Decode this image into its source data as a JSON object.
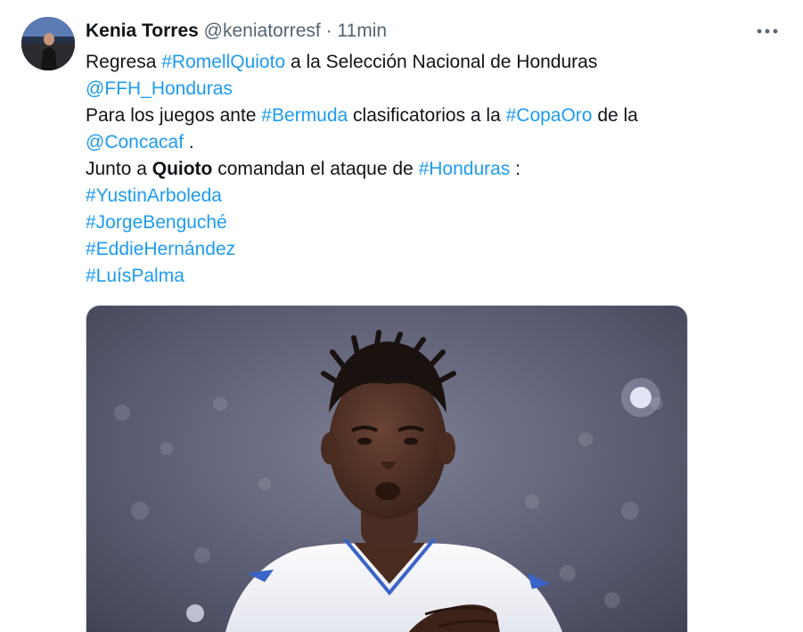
{
  "author": {
    "name": "Kenia Torres",
    "handle": "@keniatorresf",
    "separator": "·",
    "time": "11min"
  },
  "more_icon": "more-horizontal-icon",
  "tweet": {
    "l1_text1": "Regresa ",
    "l1_link1": "#RomellQuioto",
    "l1_text2": " a la Selección Nacional de Honduras",
    "l2_link1": "@FFH_Honduras",
    "l3_text1": "Para los juegos ante ",
    "l3_link1": "#Bermuda",
    "l3_text2": " clasificatorios a la ",
    "l3_link2": "#CopaOro",
    "l3_text3": " de la",
    "l4_link1": "@Concacaf",
    "l4_text1": " .",
    "l5_text1": "Junto a ",
    "l5_bold1": "Quioto",
    "l5_text2": " comandan el ataque de ",
    "l5_link1": "#Honduras",
    "l5_text3": " :",
    "hashtags": [
      "#YustinArboleda",
      "#JorgeBenguché",
      "#EddieHernández",
      "#LuísPalma"
    ]
  },
  "colors": {
    "link": "#1d9bf0",
    "text": "#0f1419",
    "secondary": "#536471",
    "jersey": "#f4f5f8",
    "jersey_trim": "#3a64c8"
  }
}
